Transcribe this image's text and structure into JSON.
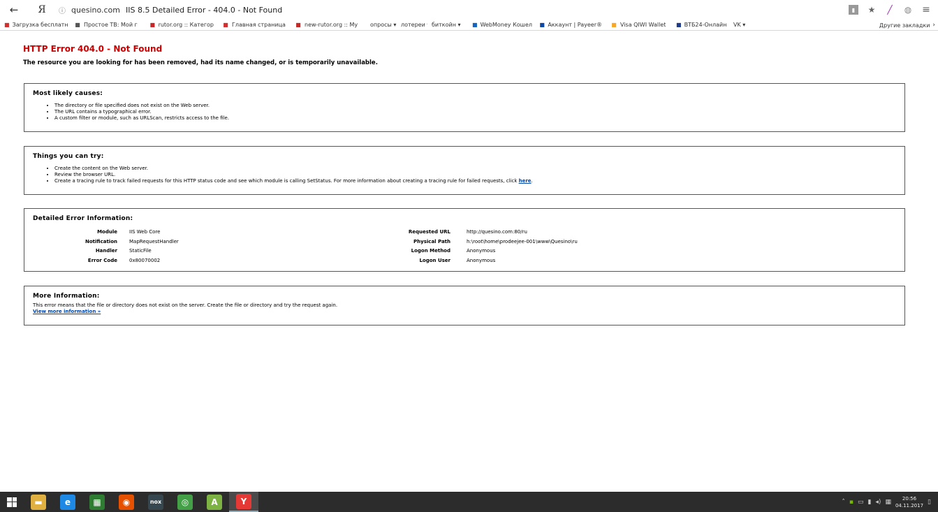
{
  "browser": {
    "back_label": "←",
    "ya_label": "Я",
    "url_sec_icon": "ⓘ",
    "url_host": "quesino.com",
    "url_title": "IIS 8.5 Detailed Error - 404.0 - Not Found",
    "bookmarks": [
      {
        "label": "Загрузка бесплатн",
        "icon": "rutracker-icon",
        "color": "#d32f2f"
      },
      {
        "label": "Простое ТВ: Мой г",
        "icon": "page-icon",
        "color": "#555"
      },
      {
        "label": "rutor.org :: Категор",
        "icon": "rutor-icon",
        "color": "#c62828"
      },
      {
        "label": "Главная страница",
        "icon": "site-icon",
        "color": "#d32f2f"
      },
      {
        "label": "new-rutor.org :: Му",
        "icon": "rutor-icon",
        "color": "#c62828"
      },
      {
        "label": "опросы ▾",
        "icon": "",
        "color": ""
      },
      {
        "label": "лотереи ▾",
        "icon": "",
        "color": ""
      },
      {
        "label": "биткойн ▾",
        "icon": "",
        "color": ""
      },
      {
        "label": "WebMoney Кошел",
        "icon": "webmoney-icon",
        "color": "#1565c0"
      },
      {
        "label": "Аккаунт | Payeer®",
        "icon": "payeer-icon",
        "color": "#0d47a1"
      },
      {
        "label": "Visa QIWI Wallet",
        "icon": "qiwi-icon",
        "color": "#f9a825"
      },
      {
        "label": "ВТБ24-Онлайн",
        "icon": "vtb-icon",
        "color": "#1e3a8a"
      },
      {
        "label": "VK ▾",
        "icon": "",
        "color": ""
      }
    ],
    "other_bookmarks": "Другие закладки",
    "star_icon": "★"
  },
  "page": {
    "h1": "HTTP Error 404.0 - Not Found",
    "h2": "The resource you are looking for has been removed, had its name changed, or is temporarily unavailable.",
    "causes": {
      "title": "Most likely causes:",
      "items": [
        "The directory or file specified does not exist on the Web server.",
        "The URL contains a typographical error.",
        "A custom filter or module, such as URLScan, restricts access to the file."
      ]
    },
    "try": {
      "title": "Things you can try:",
      "items": [
        "Create the content on the Web server.",
        "Review the browser URL.",
        "Create a tracing rule to track failed requests for this HTTP status code and see which module is calling SetStatus. For more information about creating a tracing rule for failed requests, click "
      ],
      "link": "here",
      "link_suffix": "."
    },
    "detail": {
      "title": "Detailed Error Information:",
      "left_labels": [
        "Module",
        "Notification",
        "Handler",
        "Error Code"
      ],
      "left_values": [
        "IIS Web Core",
        "MapRequestHandler",
        "StaticFile",
        "0x80070002"
      ],
      "right_labels": [
        "Requested URL",
        "Physical Path",
        "Logon Method",
        "Logon User"
      ],
      "right_values": [
        "http://quesino.com:80/ru",
        "h:\\root\\home\\prodeejee-001\\www\\Quesino\\ru",
        "Anonymous",
        "Anonymous"
      ]
    },
    "more": {
      "title": "More Information:",
      "text": "This error means that the file or directory does not exist on the server. Create the file or directory and try the request again.",
      "link": "View more information »"
    }
  },
  "taskbar": {
    "apps": [
      {
        "name": "file-explorer-icon",
        "glyph": "▬",
        "color": "#e0b040"
      },
      {
        "name": "internet-explorer-icon",
        "glyph": "e",
        "color": "#1e88e5"
      },
      {
        "name": "store-icon",
        "glyph": "▦",
        "color": "#2e7d32"
      },
      {
        "name": "firefox-icon",
        "glyph": "◉",
        "color": "#e65100"
      },
      {
        "name": "nox-icon",
        "glyph": "nox",
        "color": "#37474f"
      },
      {
        "name": "chrome-icon",
        "glyph": "◎",
        "color": "#43a047"
      },
      {
        "name": "android-studio-icon",
        "glyph": "A",
        "color": "#7cb342"
      },
      {
        "name": "yandex-browser-icon",
        "glyph": "Y",
        "color": "#e53935"
      }
    ],
    "time": "20:56",
    "date": "04.11.2017"
  }
}
